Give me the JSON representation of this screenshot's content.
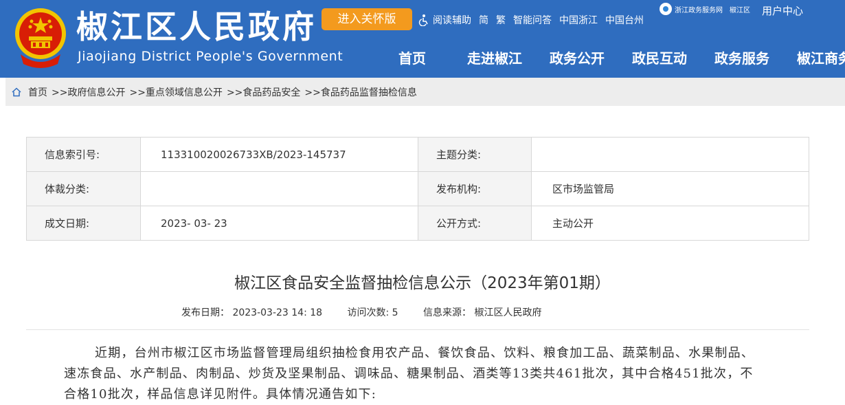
{
  "header": {
    "site_title": "椒江区人民政府",
    "site_subtitle": "Jiaojiang District People's Government",
    "care_button": "进入关怀版",
    "top_links": [
      "阅读辅助",
      "简",
      "繁",
      "智能问答",
      "中国浙江",
      "中国台州"
    ],
    "portal_name": "浙江政务服务网",
    "portal_area": "椒江区",
    "user_center": "用户中心",
    "nav": [
      "首页",
      "走进椒江",
      "政务公开",
      "政民互动",
      "政务服务",
      "椒江商务"
    ]
  },
  "breadcrumb": [
    "首页",
    ">>政府信息公开",
    ">>重点领域信息公开",
    ">>食品药品安全",
    ">>食品药品监督抽检信息"
  ],
  "meta": {
    "index_label": "信息索引号:",
    "index_value": "113310020026733XB/2023-145737",
    "topic_label": "主题分类:",
    "topic_value": "",
    "genre_label": "体裁分类:",
    "genre_value": "",
    "org_label": "发布机构:",
    "org_value": "区市场监管局",
    "date_label": "成文日期:",
    "date_value": "2023- 03- 23",
    "open_label": "公开方式:",
    "open_value": "主动公开"
  },
  "article": {
    "title": "椒江区食品安全监督抽检信息公示（2023年第01期）",
    "publish_date": "发布日期： 2023-03-23 14: 18",
    "visits": "访问次数: 5",
    "source": "信息来源： 椒江区人民政府",
    "body": "近期，台州市椒江区市场监督管理局组织抽检食用农产品、餐饮食品、饮料、粮食加工品、蔬菜制品、水果制品、速冻食品、水产制品、肉制品、炒货及坚果制品、调味品、糖果制品、酒类等13类共461批次，其中合格451批次，不合格10批次，样品信息详见附件。具体情况通告如下:"
  },
  "colors": {
    "header_bg": "#2f6dbf",
    "care_btn": "#f39a1e",
    "crumb_bg": "#ededed"
  }
}
